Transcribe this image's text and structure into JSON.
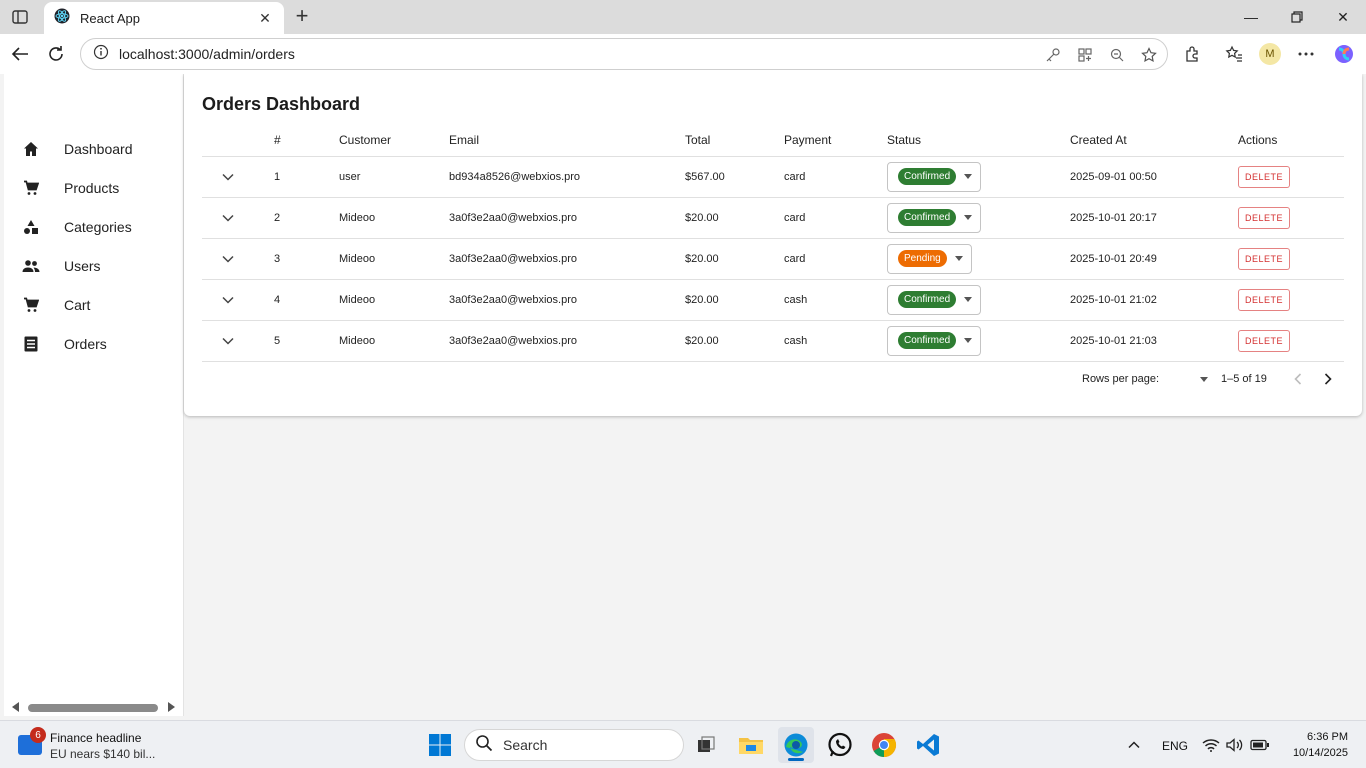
{
  "browser": {
    "tab_title": "React App",
    "url": "localhost:3000/admin/orders",
    "profile_initial": "M"
  },
  "sidebar": {
    "items": [
      {
        "label": "Dashboard",
        "icon": "home-icon"
      },
      {
        "label": "Products",
        "icon": "cart-icon"
      },
      {
        "label": "Categories",
        "icon": "category-icon"
      },
      {
        "label": "Users",
        "icon": "people-icon"
      },
      {
        "label": "Cart",
        "icon": "cart-icon"
      },
      {
        "label": "Orders",
        "icon": "list-icon"
      }
    ]
  },
  "orders": {
    "title": "Orders Dashboard",
    "columns": [
      "#",
      "Customer",
      "Email",
      "Total",
      "Payment",
      "Status",
      "Created At",
      "Actions"
    ],
    "rows": [
      {
        "num": "1",
        "customer": "user",
        "email": "bd934a8526@webxios.pro",
        "total": "$567.00",
        "payment": "card",
        "status": "Confirmed",
        "created_at": "2025-09-01 00:50",
        "action": "DELETE"
      },
      {
        "num": "2",
        "customer": "Mideoo",
        "email": "3a0f3e2aa0@webxios.pro",
        "total": "$20.00",
        "payment": "card",
        "status": "Confirmed",
        "created_at": "2025-10-01 20:17",
        "action": "DELETE"
      },
      {
        "num": "3",
        "customer": "Mideoo",
        "email": "3a0f3e2aa0@webxios.pro",
        "total": "$20.00",
        "payment": "card",
        "status": "Pending",
        "created_at": "2025-10-01 20:49",
        "action": "DELETE"
      },
      {
        "num": "4",
        "customer": "Mideoo",
        "email": "3a0f3e2aa0@webxios.pro",
        "total": "$20.00",
        "payment": "cash",
        "status": "Confirmed",
        "created_at": "2025-10-01 21:02",
        "action": "DELETE"
      },
      {
        "num": "5",
        "customer": "Mideoo",
        "email": "3a0f3e2aa0@webxios.pro",
        "total": "$20.00",
        "payment": "cash",
        "status": "Confirmed",
        "created_at": "2025-10-01 21:03",
        "action": "DELETE"
      }
    ],
    "pagination": {
      "rows_per_page_label": "Rows per page:",
      "range": "1–5 of 19"
    }
  },
  "taskbar": {
    "widget_badge": "6",
    "widget_title": "Finance headline",
    "widget_subtitle": "EU nears $140 bil...",
    "search_placeholder": "Search",
    "language": "ENG",
    "time": "6:36 PM",
    "date": "10/14/2025"
  },
  "colors": {
    "confirmed": "#2e7d32",
    "pending": "#ed6c02",
    "delete": "#d32f2f"
  }
}
